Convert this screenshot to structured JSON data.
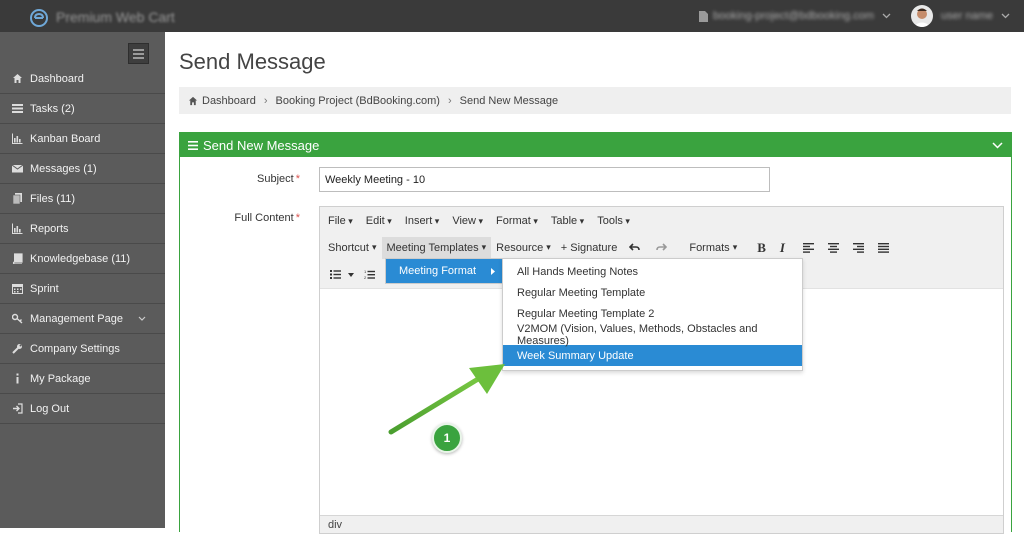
{
  "topbar": {
    "brand_text": "Premium Web Cart",
    "email": "booking-project@bdbooking.com",
    "username": "user name"
  },
  "sidebar": {
    "items": [
      {
        "label": "Dashboard",
        "icon": "home-icon"
      },
      {
        "label": "Tasks (2)",
        "icon": "tasks-icon"
      },
      {
        "label": "Kanban Board",
        "icon": "chart-icon"
      },
      {
        "label": "Messages (1)",
        "icon": "envelope-icon"
      },
      {
        "label": "Files (11)",
        "icon": "files-icon"
      },
      {
        "label": "Reports",
        "icon": "chart-icon"
      },
      {
        "label": "Knowledgebase (11)",
        "icon": "book-icon"
      },
      {
        "label": "Sprint",
        "icon": "calendar-icon"
      },
      {
        "label": "Management Page",
        "icon": "key-icon"
      },
      {
        "label": "Company Settings",
        "icon": "wrench-icon"
      },
      {
        "label": "My Package",
        "icon": "info-icon"
      },
      {
        "label": "Log Out",
        "icon": "logout-icon"
      }
    ]
  },
  "page": {
    "title": "Send Message",
    "breadcrumb": [
      "Dashboard",
      "Booking Project (BdBooking.com)",
      "Send New Message"
    ]
  },
  "panel": {
    "title": "Send New Message",
    "subject_label": "Subject",
    "subject_value": "Weekly Meeting - 10",
    "content_label": "Full Content"
  },
  "editor": {
    "menubar": [
      "File",
      "Edit",
      "Insert",
      "View",
      "Format",
      "Table",
      "Tools"
    ],
    "toolbar": {
      "shortcut": "Shortcut",
      "meeting_templates": "Meeting Templates",
      "resource": "Resource",
      "signature": "+ Signature",
      "formats": "Formats",
      "bold": "B",
      "italic": "I"
    },
    "status": "div"
  },
  "dropdown": {
    "submenu_item": "Meeting Format",
    "templates": [
      "All Hands Meeting Notes",
      "Regular Meeting Template",
      "Regular Meeting Template 2",
      "V2MOM (Vision, Values, Methods, Obstacles and Measures)",
      "Week Summary Update"
    ],
    "selected_index": 4
  },
  "annotation": {
    "badge": "1"
  },
  "colors": {
    "accent_green": "#3aa33f",
    "selection_blue": "#2a8bd4",
    "sidebar_bg": "#5b5b5b",
    "topbar_bg": "#3a3a3a"
  }
}
